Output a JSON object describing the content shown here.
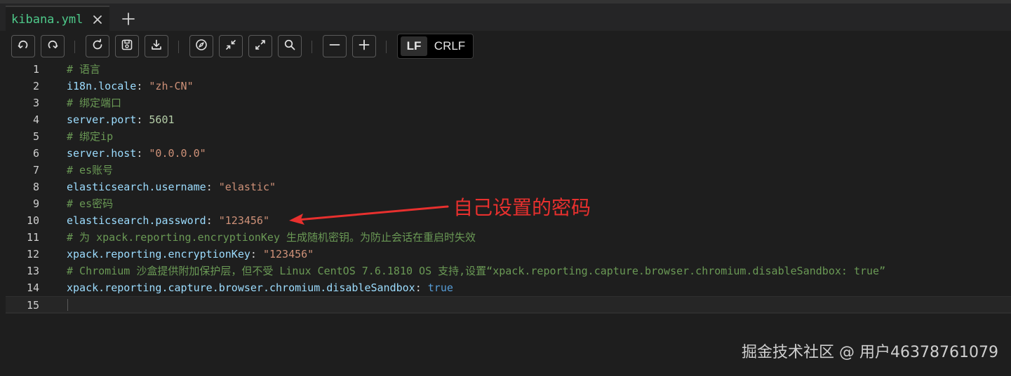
{
  "tabs": [
    {
      "title": "kibana.yml"
    }
  ],
  "toolbar": {
    "buttons": [
      {
        "icon": "undo-icon"
      },
      {
        "icon": "redo-icon"
      },
      {
        "icon": "reload-icon"
      },
      {
        "icon": "save-icon"
      },
      {
        "icon": "download-icon"
      },
      {
        "icon": "compass-icon"
      },
      {
        "icon": "collapse-icon"
      },
      {
        "icon": "expand-icon"
      },
      {
        "icon": "search-icon"
      },
      {
        "icon": "zoom-out-icon"
      },
      {
        "icon": "zoom-in-icon"
      }
    ],
    "eol": {
      "options": [
        "LF",
        "CRLF"
      ],
      "selected": "LF"
    }
  },
  "editor": {
    "current_line": 15,
    "lines": [
      {
        "n": "1",
        "comment": "# 语言"
      },
      {
        "n": "2",
        "key": "i18n.locale",
        "sep": ": ",
        "value": "\"zh-CN\"",
        "vtype": "str"
      },
      {
        "n": "3",
        "comment": "# 绑定端口"
      },
      {
        "n": "4",
        "key": "server.port",
        "sep": ": ",
        "value": "5601",
        "vtype": "num"
      },
      {
        "n": "5",
        "comment": "# 绑定ip"
      },
      {
        "n": "6",
        "key": "server.host",
        "sep": ": ",
        "value": "\"0.0.0.0\"",
        "vtype": "str"
      },
      {
        "n": "7",
        "comment": "# es账号"
      },
      {
        "n": "8",
        "key": "elasticsearch.username",
        "sep": ": ",
        "value": "\"elastic\"",
        "vtype": "str"
      },
      {
        "n": "9",
        "comment": "# es密码"
      },
      {
        "n": "10",
        "key": "elasticsearch.password",
        "sep": ": ",
        "value": "\"123456\"",
        "vtype": "str"
      },
      {
        "n": "11",
        "comment": "# 为 xpack.reporting.encryptionKey 生成随机密钥。为防止会话在重启时失效"
      },
      {
        "n": "12",
        "key": "xpack.reporting.encryptionKey",
        "sep": ": ",
        "value": "\"123456\"",
        "vtype": "str"
      },
      {
        "n": "13",
        "comment": "# Chromium 沙盒提供附加保护层，但不受 Linux CentOS 7.6.1810 OS 支持,设置“xpack.reporting.capture.browser.chromium.disableSandbox: true”"
      },
      {
        "n": "14",
        "key": "xpack.reporting.capture.browser.chromium.disableSandbox",
        "sep": ": ",
        "value": "true",
        "vtype": "bool"
      },
      {
        "n": "15"
      }
    ]
  },
  "annotation": {
    "text": "自己设置的密码",
    "color": "#e8302e"
  },
  "watermark": "掘金技术社区 @ 用户46378761079",
  "colors": {
    "background": "#1e1e1e",
    "tab_title": "#4ec98a",
    "comment": "#6a9955",
    "key": "#9cdcfe",
    "string": "#ce9178",
    "number": "#b5cea8",
    "boolean": "#569cd6"
  }
}
